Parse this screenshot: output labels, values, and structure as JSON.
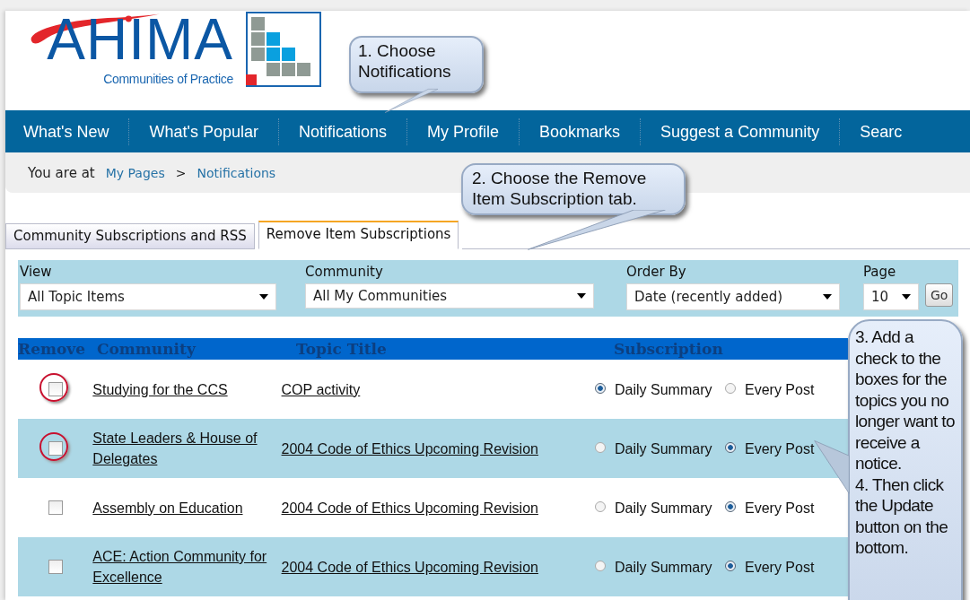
{
  "logo": {
    "name": "AHIMA",
    "tagline": "Communities of Practice"
  },
  "nav": [
    {
      "label": "What's New"
    },
    {
      "label": "What's Popular"
    },
    {
      "label": "Notifications"
    },
    {
      "label": "My Profile"
    },
    {
      "label": "Bookmarks"
    },
    {
      "label": "Suggest a Community"
    },
    {
      "label": "Searc"
    }
  ],
  "breadcrumb": {
    "prefix": "You are at",
    "items": [
      "My Pages",
      "Notifications"
    ],
    "separator": ">"
  },
  "tabs": [
    {
      "label": "Community Subscriptions and RSS",
      "selected": false
    },
    {
      "label": "Remove Item Subscriptions",
      "selected": true
    }
  ],
  "filters": [
    {
      "label": "View",
      "value": "All Topic Items"
    },
    {
      "label": "Community",
      "value": "All My Communities"
    },
    {
      "label": "Order By",
      "value": "Date (recently added)"
    },
    {
      "label": "Page",
      "value": "10"
    }
  ],
  "go_button": "Go",
  "table": {
    "columns": [
      "Remove",
      "Community",
      "Topic Title",
      "Subscription"
    ],
    "rows": [
      {
        "checked": false,
        "highlighted": true,
        "community": "Studying for the CCS",
        "topic": "COP activity",
        "options": [
          {
            "label": "Daily Summary",
            "selected": true
          },
          {
            "label": "Every Post",
            "selected": false
          }
        ]
      },
      {
        "checked": false,
        "highlighted": true,
        "community": "State Leaders & House of Delegates",
        "topic": "2004 Code of Ethics Upcoming Revision",
        "options": [
          {
            "label": "Daily Summary",
            "selected": false
          },
          {
            "label": "Every Post",
            "selected": true
          }
        ]
      },
      {
        "checked": false,
        "highlighted": false,
        "community": "Assembly on Education",
        "topic": "2004 Code of Ethics Upcoming Revision",
        "options": [
          {
            "label": "Daily Summary",
            "selected": false
          },
          {
            "label": "Every Post",
            "selected": true
          }
        ]
      },
      {
        "checked": false,
        "highlighted": false,
        "community": "ACE: Action Community for Excellence",
        "topic": "2004 Code of Ethics Upcoming Revision",
        "options": [
          {
            "label": "Daily Summary",
            "selected": false
          },
          {
            "label": "Every Post",
            "selected": true
          }
        ]
      }
    ]
  },
  "callouts": [
    {
      "kind": "top",
      "text": "1. Choose Notifications"
    },
    {
      "kind": "tab",
      "text": "2. Choose the Remove Item Subscription tab."
    },
    {
      "kind": "side",
      "text": "3. Add a check to the boxes for the topics you no longer want to receive a notice.\n4. Then click the Update button on the bottom."
    }
  ]
}
